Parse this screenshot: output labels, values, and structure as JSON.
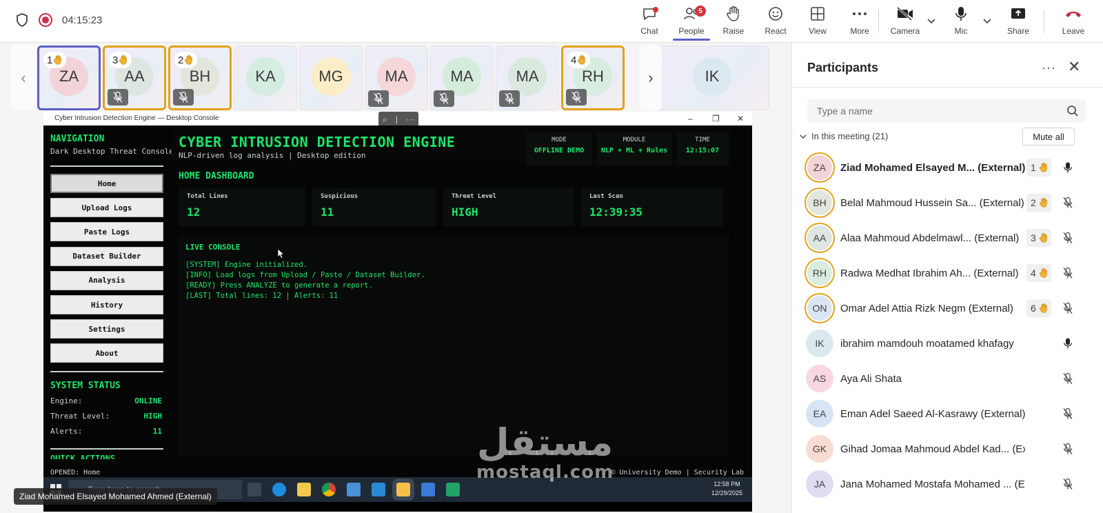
{
  "meeting": {
    "timer": "04:15:23"
  },
  "toolbar": {
    "chat": "Chat",
    "people": "People",
    "people_count": "5",
    "raise": "Raise",
    "react": "React",
    "view": "View",
    "more": "More",
    "camera": "Camera",
    "mic": "Mic",
    "share": "Share",
    "leave": "Leave"
  },
  "strip": {
    "tiles": [
      {
        "initials": "ZA",
        "hand": "1",
        "avatar_color": "#f2d3d8"
      },
      {
        "initials": "AA",
        "hand": "3",
        "avatar_color": "#dde6e0"
      },
      {
        "initials": "BH",
        "hand": "2",
        "avatar_color": "#e2e6dc"
      },
      {
        "initials": "KA",
        "avatar_color": "#d5ece0"
      },
      {
        "initials": "MG",
        "avatar_color": "#fbedc5"
      },
      {
        "initials": "MA",
        "avatar_color": "#f5d6d9"
      },
      {
        "initials": "MA",
        "avatar_color": "#d4ecdc"
      },
      {
        "initials": "MA",
        "avatar_color": "#dbe8df"
      },
      {
        "initials": "RH",
        "hand": "4",
        "avatar_color": "#d8ecdf"
      },
      {
        "initials": "IK",
        "avatar_color": "#dbe8ef"
      }
    ]
  },
  "shared_screen": {
    "window_title": "Cyber Intrusion Detection Engine — Desktop Console",
    "nav_title": "NAVIGATION",
    "nav_subtitle": "Dark Desktop Threat Console",
    "nav_items": [
      "Home",
      "Upload Logs",
      "Paste Logs",
      "Dataset Builder",
      "Analysis",
      "History",
      "Settings",
      "About"
    ],
    "system_status_title": "SYSTEM STATUS",
    "status": [
      {
        "label": "Engine:",
        "value": "ONLINE"
      },
      {
        "label": "Threat Level:",
        "value": "HIGH"
      },
      {
        "label": "Alerts:",
        "value": "11"
      }
    ],
    "quick_actions": "QUICK ACTIONS",
    "title": "CYBER INTRUSION DETECTION ENGINE",
    "subtitle": "NLP-driven log analysis | Desktop edition",
    "mode_label": "MODE",
    "mode_value": "OFFLINE DEMO",
    "module_label": "MODULE",
    "module_value": "NLP + ML + Rules",
    "time_label": "TIME",
    "time_value": "12:15:07",
    "section": "HOME DASHBOARD",
    "cards": [
      {
        "label": "Total Lines",
        "value": "12"
      },
      {
        "label": "Suspicious",
        "value": "11"
      },
      {
        "label": "Threat Level",
        "value": "HIGH"
      },
      {
        "label": "Last Scan",
        "value": "12:39:35"
      }
    ],
    "console_title": "LIVE CONSOLE",
    "console_lines": [
      "[SYSTEM] Engine initialized.",
      "[INFO] Load logs from Upload / Paste / Dataset Builder.",
      "[READY] Press ANALYZE to generate a report.",
      "[LAST] Total lines: 12 | Alerts: 11"
    ],
    "footer_left": "OPENED: Home",
    "footer_right": "© University Demo | Security Lab",
    "taskbar_search": "Type here to search",
    "tray_time": "12:58 PM",
    "tray_date": "12/29/2025",
    "watermark_ar": "مستقل",
    "watermark_en": "mostaql.com"
  },
  "caption": "Ziad Mohamed Elsayed Mohamed Ahmed (External)",
  "participants": {
    "title": "Participants",
    "search_placeholder": "Type a name",
    "section": "In this meeting (21)",
    "mute_all": "Mute all",
    "people": [
      {
        "initials": "ZA",
        "name": "Ziad Mohamed Elsayed M... (External)",
        "hand": "1",
        "mic": "on",
        "ring": true,
        "color": "#f2d3d8",
        "bold": true
      },
      {
        "initials": "BH",
        "name": "Belal Mahmoud Hussein Sa... (External)",
        "hand": "2",
        "mic": "off",
        "ring": true,
        "color": "#e2e6dc"
      },
      {
        "initials": "AA",
        "name": "Alaa Mahmoud Abdelmawl... (External)",
        "hand": "3",
        "mic": "off",
        "ring": true,
        "color": "#dde6e0"
      },
      {
        "initials": "RH",
        "name": "Radwa Medhat Ibrahim Ah... (External)",
        "hand": "4",
        "mic": "off",
        "ring": true,
        "color": "#d8ecdf"
      },
      {
        "initials": "ON",
        "name": "Omar Adel Attia Rizk Negm (External)",
        "hand": "6",
        "mic": "off",
        "ring": true,
        "color": "#dbe6f5"
      },
      {
        "initials": "IK",
        "name": "ibrahim mamdouh moatamed khafagy",
        "mic": "on",
        "color": "#dbe8ef"
      },
      {
        "initials": "AS",
        "name": "Aya Ali Shata",
        "mic": "off",
        "color": "#f8d7e3"
      },
      {
        "initials": "EA",
        "name": "Eman Adel Saeed Al-Kasrawy (External)",
        "mic": "off",
        "color": "#d6e4f5"
      },
      {
        "initials": "GK",
        "name": "Gihad Jomaa Mahmoud Abdel Kad... (External)",
        "mic": "off",
        "color": "#f8dcd3"
      },
      {
        "initials": "JA",
        "name": "Jana Mohamed Mostafa Mohamed ... (External)",
        "mic": "off",
        "color": "#e2dcf2"
      }
    ]
  }
}
